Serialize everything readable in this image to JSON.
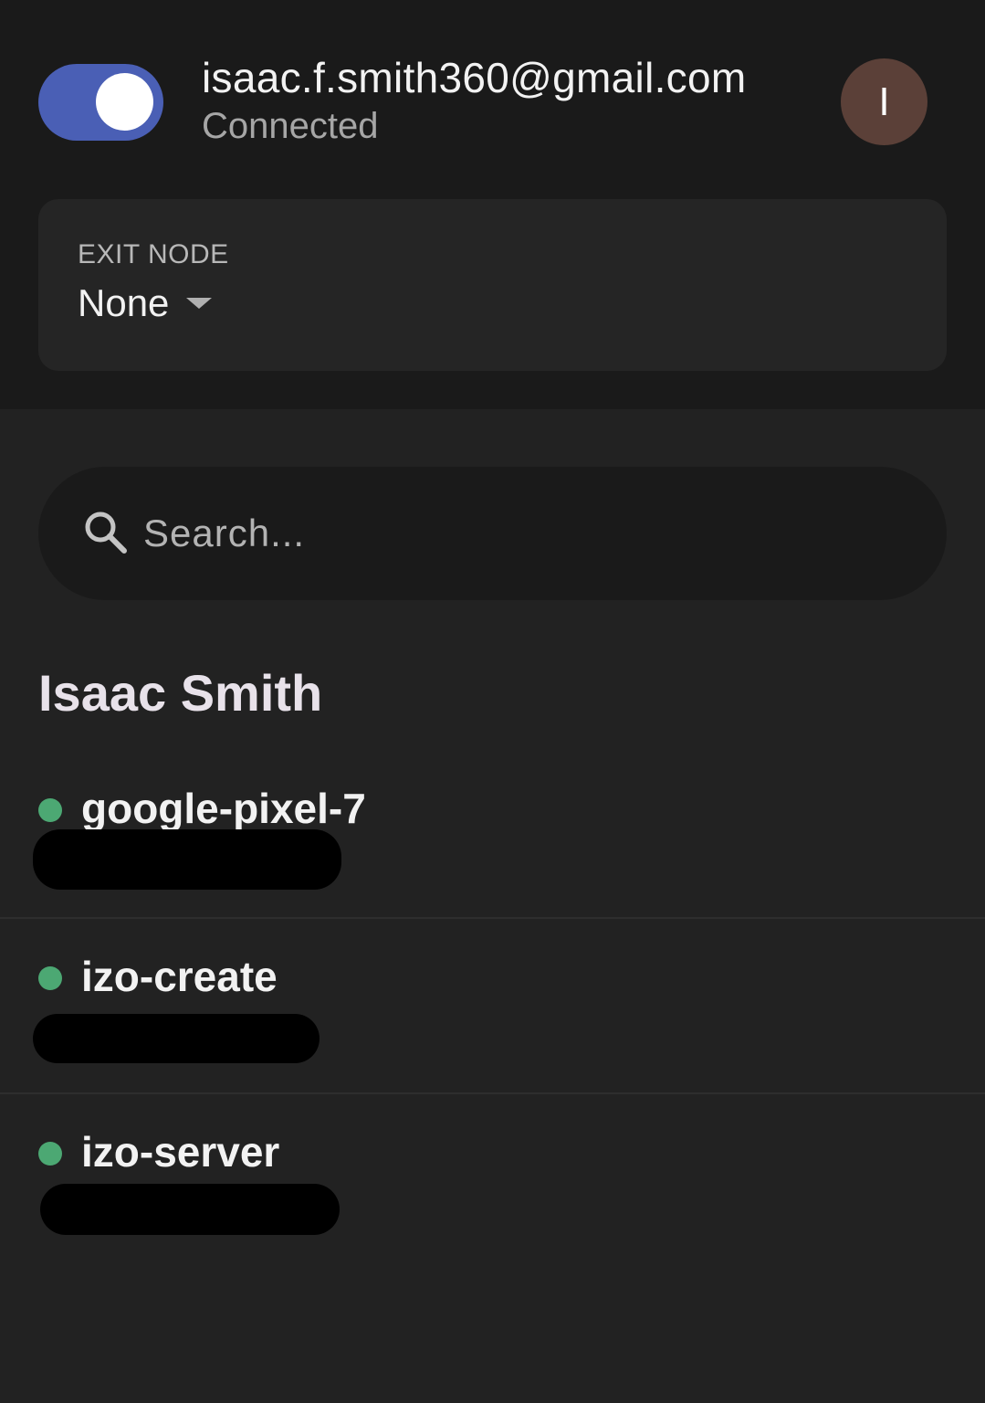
{
  "account": {
    "email": "isaac.f.smith360@gmail.com",
    "status": "Connected",
    "avatar_initial": "I",
    "vpn_toggle_on": true,
    "toggle_color": "#4a5fb5",
    "avatar_color": "#5b4038"
  },
  "exit_node": {
    "label": "EXIT NODE",
    "value": "None"
  },
  "search": {
    "placeholder": "Search..."
  },
  "section": {
    "owner_name": "Isaac Smith"
  },
  "devices": [
    {
      "name": "google-pixel-7",
      "online": true,
      "address_redacted": true
    },
    {
      "name": "izo-create",
      "online": true,
      "address_redacted": true
    },
    {
      "name": "izo-server",
      "online": true,
      "address_redacted": true
    }
  ],
  "colors": {
    "background": "#222222",
    "header_background": "#1a1a1a",
    "online_dot": "#4ca873"
  },
  "icons": {
    "search": "search-icon",
    "dropdown": "chevron-down-icon",
    "status": "status-dot-icon"
  }
}
